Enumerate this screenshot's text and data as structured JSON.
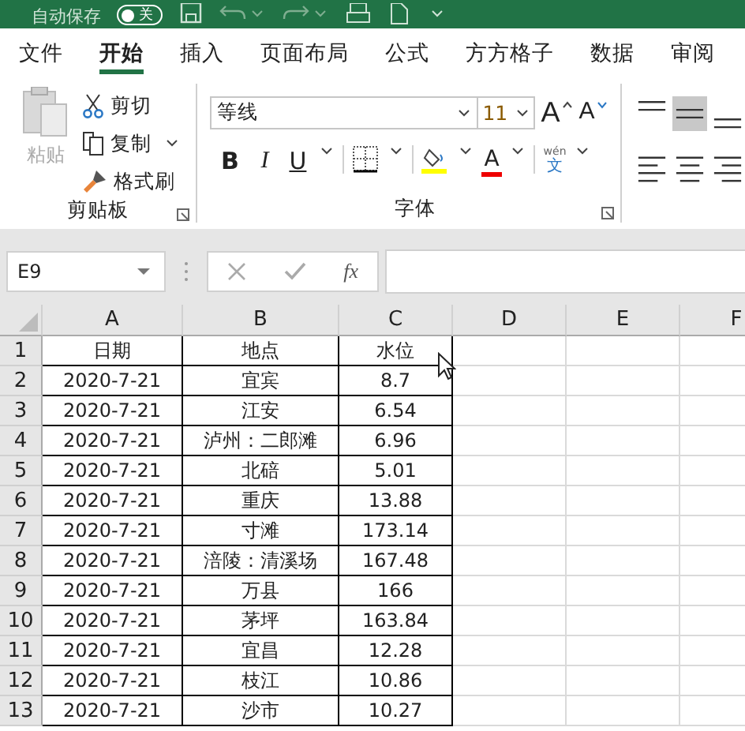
{
  "title_bar": {
    "autosave_label": "自动保存",
    "autosave_toggle": {
      "label": "关",
      "on": false
    }
  },
  "tabs": [
    {
      "label": "文件",
      "selected": false
    },
    {
      "label": "开始",
      "selected": true
    },
    {
      "label": "插入",
      "selected": false
    },
    {
      "label": "页面布局",
      "selected": false
    },
    {
      "label": "公式",
      "selected": false
    },
    {
      "label": "方方格子",
      "selected": false
    },
    {
      "label": "数据",
      "selected": false
    },
    {
      "label": "审阅",
      "selected": false
    }
  ],
  "ribbon": {
    "clipboard": {
      "paste": "粘贴",
      "cut": "剪切",
      "copy": "复制",
      "format_painter": "格式刷",
      "group_label": "剪贴板"
    },
    "font": {
      "font_name": "等线",
      "font_size": "11",
      "grow": "A",
      "shrink": "A",
      "bold": "B",
      "italic": "I",
      "underline": "U",
      "font_color": "A",
      "phonetic_top": "wén",
      "phonetic_bottom": "文",
      "group_label": "字体"
    },
    "alignment": [
      {
        "kind": "top",
        "selected": false
      },
      {
        "kind": "middle",
        "selected": true
      },
      {
        "kind": "bottom",
        "selected": false
      },
      {
        "kind": "left",
        "selected": false
      },
      {
        "kind": "center",
        "selected": false
      },
      {
        "kind": "right",
        "selected": false
      }
    ]
  },
  "formula_bar": {
    "name_box": "E9",
    "function_label": "fx"
  },
  "sheet": {
    "columns": [
      "A",
      "B",
      "C",
      "D",
      "E",
      "F"
    ],
    "rows": [
      {
        "number": "1",
        "cells": [
          "日期",
          "地点",
          "水位"
        ]
      },
      {
        "number": "2",
        "cells": [
          "2020-7-21",
          "宜宾",
          "8.7"
        ]
      },
      {
        "number": "3",
        "cells": [
          "2020-7-21",
          "江安",
          "6.54"
        ]
      },
      {
        "number": "4",
        "cells": [
          "2020-7-21",
          "泸州：二郎滩",
          "6.96"
        ]
      },
      {
        "number": "5",
        "cells": [
          "2020-7-21",
          "北碚",
          "5.01"
        ]
      },
      {
        "number": "6",
        "cells": [
          "2020-7-21",
          "重庆",
          "13.88"
        ]
      },
      {
        "number": "7",
        "cells": [
          "2020-7-21",
          "寸滩",
          "173.14"
        ]
      },
      {
        "number": "8",
        "cells": [
          "2020-7-21",
          "涪陵：清溪场",
          "167.48"
        ]
      },
      {
        "number": "9",
        "cells": [
          "2020-7-21",
          "万县",
          "166"
        ]
      },
      {
        "number": "10",
        "cells": [
          "2020-7-21",
          "茅坪",
          "163.84"
        ]
      },
      {
        "number": "11",
        "cells": [
          "2020-7-21",
          "宜昌",
          "12.28"
        ]
      },
      {
        "number": "12",
        "cells": [
          "2020-7-21",
          "枝江",
          "10.86"
        ]
      },
      {
        "number": "13",
        "cells": [
          "2020-7-21",
          "沙市",
          "10.27"
        ]
      }
    ]
  }
}
